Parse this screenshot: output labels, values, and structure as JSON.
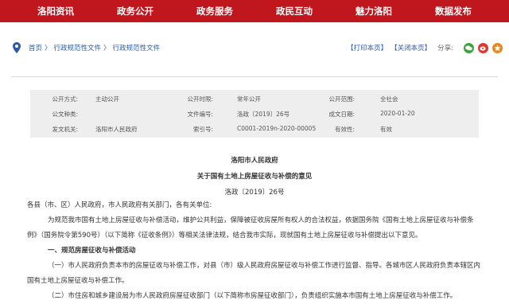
{
  "nav": {
    "items": [
      "洛阳资讯",
      "政务公开",
      "政务服务",
      "政民互动",
      "魅力洛阳",
      "数据发布"
    ]
  },
  "breadcrumb": {
    "home": "首页",
    "level1": "行政规范性文件",
    "level2": "行政规范性文件",
    "separator": "〉"
  },
  "actions": {
    "print": "【打印本页】",
    "close": "【关闭本页】",
    "share_label": "分享:",
    "share_icons": [
      "wechat-icon",
      "weibo-icon",
      "qzone-icon"
    ],
    "share_colors": [
      "#3aa63a",
      "#e2352b",
      "#e9871f"
    ]
  },
  "meta": {
    "row1": {
      "l1": "公开方式:",
      "v1": "主动公开",
      "l2": "公开时限:",
      "v2": "常年公开",
      "l3": "公开范围:",
      "v3": "全社会"
    },
    "row2": {
      "l1": "公文种类:",
      "v1": "",
      "l2": "文件编号:",
      "v2": "洛政〔2019〕26号",
      "l3": "成文日期:",
      "v3": "2020-01-20"
    },
    "row3": {
      "l1": "发文机关:",
      "v1": "洛阳市人民政府",
      "l2": "索引号:",
      "v2": "C0001-2019n-2020-00005",
      "l3": "有效性:",
      "v3": "有效"
    }
  },
  "document": {
    "issuer": "洛阳市人民政府",
    "title": "关于国有土地上房屋征收与补偿的意见",
    "number": "洛政〔2019〕26号",
    "salutation": "各县（市、区）人民政府，市人民政府有关部门，各有关单位:",
    "p1_line1": "为规范我市国有土地上房屋征收与补偿活动，维护公共利益，保障被征收房屋所有权人的合法权益，依据国务院《国有土地上房屋征收与补偿条",
    "p1_line2": "例》（国务院令第590号）（以下简称《征收条例》）等相关法律法规，结合我市实际，现就国有土地上房屋征收与补偿提出以下意见。",
    "section1": "一、规范房屋征收与补偿活动",
    "p2_line1": "（一）市人民政府负责本市的房屋征收与补偿工作，对县（市）级人民政府房屋征收与补偿工作进行监督、指导。各城市区人民政府负责本辖区内",
    "p2_line2": "国有土地上房屋征收与补偿工作。",
    "p3_line1": "（二）市住房和城乡建设局为市人民政府房屋征收部门（以下简称市房屋征收部门），负责组织实施本市国有土地上房屋征收与补偿工作。"
  },
  "colors": {
    "nav_bg": "#c0161d",
    "link": "#2d5aa8",
    "meta_bg": "#eeeeee"
  }
}
